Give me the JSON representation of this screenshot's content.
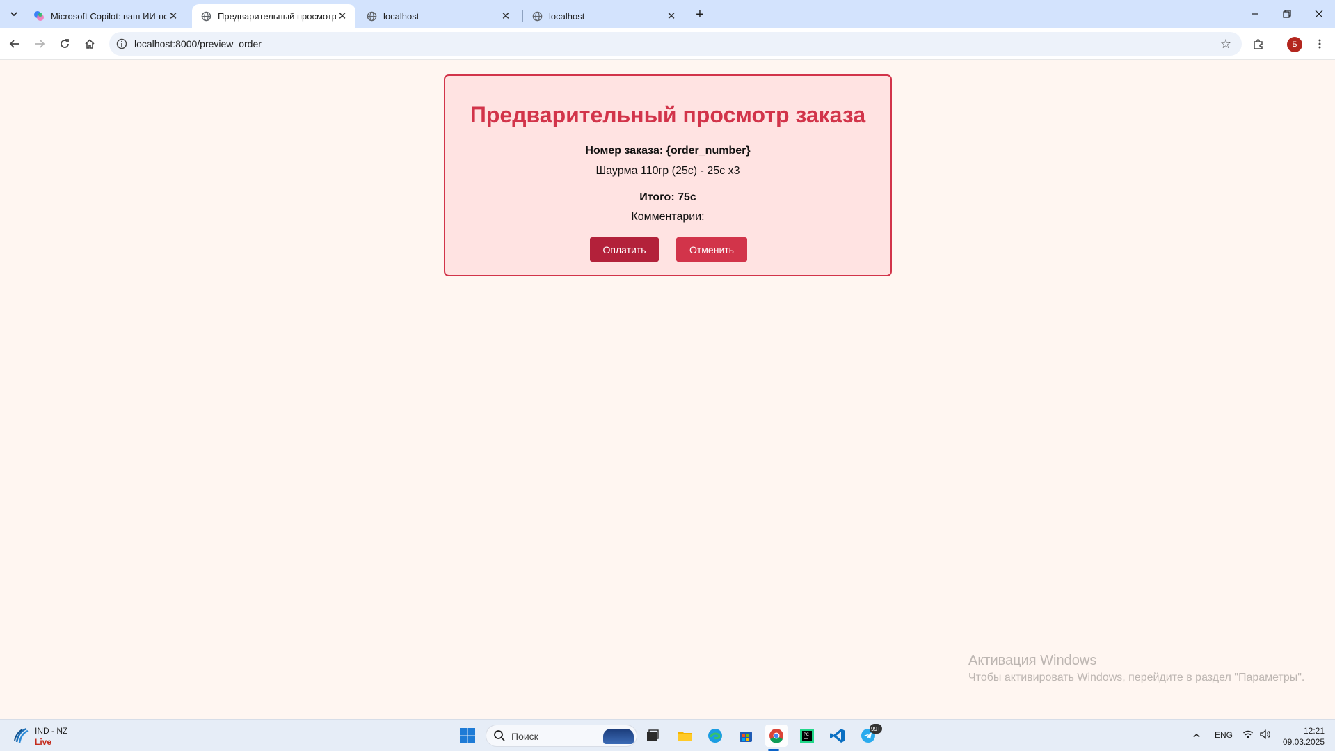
{
  "browser": {
    "tabs": [
      {
        "title": "Microsoft Copilot: ваш ИИ-пом",
        "favicon": "copilot-icon",
        "active": false
      },
      {
        "title": "Предварительный просмотр з",
        "favicon": "globe-icon",
        "active": true
      },
      {
        "title": "localhost",
        "favicon": "globe-icon",
        "active": false
      },
      {
        "title": "localhost",
        "favicon": "globe-icon",
        "active": false
      }
    ],
    "url": "localhost:8000/preview_order",
    "profile_initial": "Б"
  },
  "order": {
    "title": "Предварительный просмотр заказа",
    "number_line": "Номер заказа: {order_number}",
    "item_line": "Шаурма 110гр (25с) - 25с x3",
    "total_line": "Итого: 75с",
    "comments_line": "Комментарии:",
    "pay_label": "Оплатить",
    "cancel_label": "Отменить"
  },
  "watermark": {
    "title": "Активация Windows",
    "subtitle": "Чтобы активировать Windows, перейдите в раздел \"Параметры\"."
  },
  "taskbar": {
    "weather_line1": "IND - NZ",
    "weather_line2": "Live",
    "search_placeholder": "Поиск",
    "telegram_badge": "99+",
    "language": "ENG",
    "time": "12:21",
    "date": "09.03.2025"
  },
  "colors": {
    "accent": "#d2344a",
    "pay_button": "#b3213a",
    "card_bg": "#ffe3e2",
    "page_bg": "#fff6f1"
  }
}
